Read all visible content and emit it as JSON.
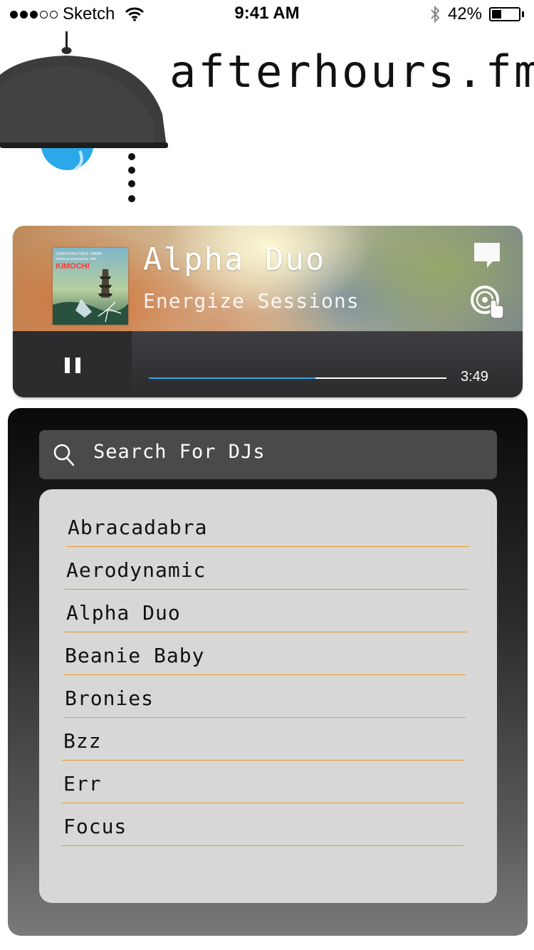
{
  "status_bar": {
    "carrier": "Sketch",
    "time": "9:41 AM",
    "battery": "42%",
    "battery_level": 0.42,
    "signal_bars": 3
  },
  "header": {
    "title": "afterhours.fm"
  },
  "player": {
    "artist": "Alpha Duo",
    "show": "Energize Sessions",
    "album": {
      "line1": "CHRISTIAN PRES. MANA",
      "line2": "REMIX & CHANGITHE VIBE",
      "title": "KIMOCHI"
    },
    "time": "3:49",
    "progress": 0.56,
    "accent": "#2ea6e6"
  },
  "search": {
    "placeholder": "Search For DJs",
    "value": ""
  },
  "dj_list": {
    "items": [
      {
        "label": "Abracadabra"
      },
      {
        "label": "Aerodynamic"
      },
      {
        "label": "Alpha Duo"
      },
      {
        "label": "Beanie Baby"
      },
      {
        "label": "Bronies"
      },
      {
        "label": "Bzz"
      },
      {
        "label": "Err"
      },
      {
        "label": "Focus"
      }
    ],
    "divider_color": "#e39a2d"
  }
}
